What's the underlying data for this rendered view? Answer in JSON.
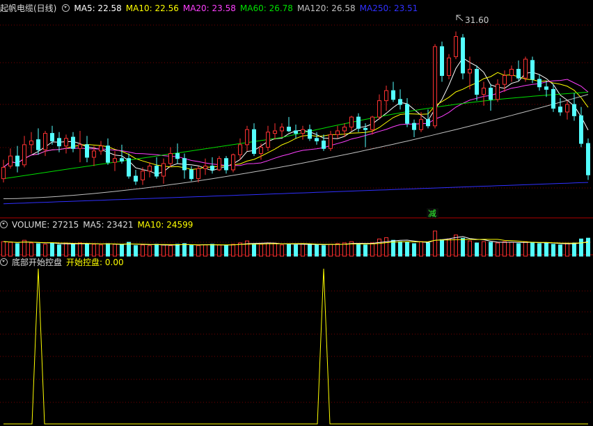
{
  "price_panel": {
    "title": "起帆电缆(日线)",
    "ma5": "MA5: 22.58",
    "ma10": "MA10: 22.56",
    "ma20": "MA20: 23.58",
    "ma60": "MA60: 26.78",
    "ma120": "MA120: 26.58",
    "ma250": "MA250: 23.51",
    "high_marker": "31.60",
    "signal_label": "减"
  },
  "volume_panel": {
    "volume": "VOLUME: 27215",
    "ma5": "MA5: 23421",
    "ma10": "MA10: 24599"
  },
  "indicator_panel": {
    "title": "底部开始控盘",
    "value": "开始控盘: 0.00"
  },
  "colors": {
    "up": "#ff3232",
    "down": "#54ffff",
    "ma5": "#ffffff",
    "ma10": "#ffff00",
    "ma20": "#ff40ff",
    "ma60": "#00e000",
    "ma120": "#c0c0c0",
    "ma250": "#3030ff",
    "grid": "#7a0000",
    "indicator": "#ffff00"
  },
  "chart_data": {
    "type": "candlestick",
    "price_ylim": [
      17.5,
      33.0
    ],
    "ohlc": [
      [
        19.9,
        21.4,
        19.6,
        20.8
      ],
      [
        20.9,
        22.3,
        20.7,
        21.7
      ],
      [
        21.7,
        22.5,
        20.4,
        20.9
      ],
      [
        21.0,
        23.3,
        20.8,
        22.6
      ],
      [
        22.6,
        23.6,
        21.9,
        22.9
      ],
      [
        23.0,
        23.9,
        21.8,
        22.2
      ],
      [
        22.2,
        23.7,
        21.7,
        23.5
      ],
      [
        23.5,
        24.1,
        22.6,
        22.9
      ],
      [
        23.1,
        23.6,
        22.0,
        22.5
      ],
      [
        22.5,
        23.4,
        21.9,
        23.1
      ],
      [
        23.2,
        23.6,
        22.0,
        22.3
      ],
      [
        22.3,
        23.7,
        21.2,
        22.6
      ],
      [
        22.6,
        23.3,
        21.2,
        21.6
      ],
      [
        21.6,
        22.5,
        20.9,
        22.1
      ],
      [
        22.1,
        22.9,
        21.8,
        22.5
      ],
      [
        22.5,
        23.1,
        21.0,
        21.2
      ],
      [
        21.2,
        22.1,
        20.5,
        21.5
      ],
      [
        21.5,
        22.6,
        21.1,
        21.3
      ],
      [
        21.5,
        21.9,
        19.9,
        20.1
      ],
      [
        20.1,
        20.6,
        19.4,
        19.7
      ],
      [
        19.8,
        20.8,
        19.4,
        20.5
      ],
      [
        20.5,
        21.2,
        20.0,
        20.9
      ],
      [
        20.9,
        21.6,
        19.9,
        20.1
      ],
      [
        20.1,
        21.5,
        19.5,
        21.1
      ],
      [
        21.1,
        22.4,
        20.8,
        21.9
      ],
      [
        21.9,
        22.7,
        21.1,
        21.5
      ],
      [
        21.5,
        21.9,
        19.9,
        20.6
      ],
      [
        20.6,
        20.9,
        19.7,
        19.9
      ],
      [
        19.9,
        20.9,
        19.6,
        20.7
      ],
      [
        20.7,
        21.5,
        20.2,
        20.9
      ],
      [
        20.9,
        21.6,
        20.3,
        20.6
      ],
      [
        20.6,
        21.7,
        20.5,
        21.5
      ],
      [
        21.5,
        21.7,
        20.3,
        20.6
      ],
      [
        20.6,
        21.9,
        20.4,
        21.8
      ],
      [
        21.8,
        23.1,
        21.4,
        22.6
      ],
      [
        22.6,
        24.1,
        22.1,
        23.8
      ],
      [
        23.8,
        24.3,
        21.7,
        21.9
      ],
      [
        21.9,
        22.7,
        21.4,
        22.4
      ],
      [
        22.4,
        24.1,
        22.1,
        23.6
      ],
      [
        23.5,
        24.3,
        23.0,
        23.7
      ],
      [
        23.7,
        24.3,
        23.2,
        24.0
      ],
      [
        24.0,
        24.8,
        23.6,
        23.7
      ],
      [
        23.7,
        24.2,
        23.1,
        23.5
      ],
      [
        23.5,
        24.1,
        23.0,
        23.8
      ],
      [
        23.8,
        24.2,
        22.9,
        23.1
      ],
      [
        23.1,
        23.6,
        22.6,
        22.9
      ],
      [
        22.9,
        23.4,
        22.1,
        22.3
      ],
      [
        22.3,
        23.7,
        22.1,
        23.4
      ],
      [
        23.4,
        24.1,
        23.1,
        23.7
      ],
      [
        23.7,
        24.3,
        23.2,
        24.0
      ],
      [
        24.0,
        24.9,
        23.7,
        24.8
      ],
      [
        24.8,
        25.1,
        23.6,
        23.9
      ],
      [
        23.9,
        24.3,
        22.4,
        23.8
      ],
      [
        23.8,
        24.9,
        23.4,
        24.8
      ],
      [
        24.8,
        26.6,
        24.6,
        26.1
      ],
      [
        26.1,
        27.3,
        25.3,
        26.9
      ],
      [
        26.9,
        27.6,
        26.0,
        26.2
      ],
      [
        26.2,
        27.0,
        25.4,
        25.8
      ],
      [
        25.8,
        26.3,
        24.0,
        24.3
      ],
      [
        24.3,
        24.6,
        23.2,
        23.8
      ],
      [
        23.8,
        25.2,
        23.6,
        24.6
      ],
      [
        24.6,
        25.4,
        23.9,
        24.1
      ],
      [
        24.1,
        30.6,
        23.9,
        30.4
      ],
      [
        30.4,
        30.8,
        27.6,
        28.1
      ],
      [
        28.1,
        29.8,
        27.8,
        29.5
      ],
      [
        29.6,
        31.6,
        29.4,
        31.2
      ],
      [
        31.1,
        31.4,
        27.8,
        28.3
      ],
      [
        28.3,
        29.6,
        27.0,
        28.6
      ],
      [
        28.6,
        28.9,
        26.1,
        26.6
      ],
      [
        26.6,
        27.6,
        25.7,
        27.1
      ],
      [
        27.1,
        27.4,
        25.3,
        26.2
      ],
      [
        26.2,
        27.8,
        26.0,
        27.4
      ],
      [
        27.4,
        28.5,
        26.8,
        28.1
      ],
      [
        28.1,
        28.9,
        27.6,
        28.6
      ],
      [
        28.6,
        29.3,
        27.7,
        27.9
      ],
      [
        27.9,
        29.6,
        27.6,
        29.4
      ],
      [
        29.3,
        29.6,
        27.5,
        27.8
      ],
      [
        27.8,
        28.2,
        26.9,
        27.2
      ],
      [
        27.2,
        27.7,
        26.4,
        27.0
      ],
      [
        27.0,
        27.4,
        25.2,
        25.5
      ],
      [
        25.6,
        26.3,
        24.9,
        25.2
      ],
      [
        25.2,
        26.1,
        24.6,
        25.8
      ],
      [
        25.8,
        26.7,
        24.5,
        24.9
      ],
      [
        24.9,
        25.6,
        22.4,
        22.7
      ],
      [
        22.7,
        23.1,
        19.8,
        20.2
      ]
    ],
    "volume_ylim": [
      0,
      40000
    ],
    "volume": [
      22000,
      21000,
      19000,
      24000,
      20000,
      19000,
      18000,
      20000,
      17000,
      19000,
      18000,
      20000,
      19000,
      18000,
      17000,
      19000,
      18000,
      17000,
      21000,
      16000,
      17000,
      16000,
      18000,
      17000,
      16000,
      18000,
      19000,
      17000,
      16000,
      17000,
      18000,
      17000,
      16000,
      18000,
      20000,
      23000,
      19000,
      18000,
      20000,
      19000,
      17000,
      18000,
      17000,
      19000,
      18000,
      17000,
      16000,
      18000,
      19000,
      20000,
      22000,
      18000,
      17000,
      20000,
      26000,
      28000,
      24000,
      22000,
      21000,
      19000,
      22000,
      20000,
      38000,
      25000,
      26000,
      32000,
      27000,
      23000,
      20000,
      22000,
      21000,
      20000,
      22000,
      21000,
      19000,
      22000,
      21000,
      19000,
      20000,
      18000,
      17000,
      19000,
      20000,
      26000,
      27215
    ],
    "indicator_ylim": [
      0,
      1
    ],
    "indicator": {
      "spikes": [
        5,
        46
      ]
    }
  }
}
